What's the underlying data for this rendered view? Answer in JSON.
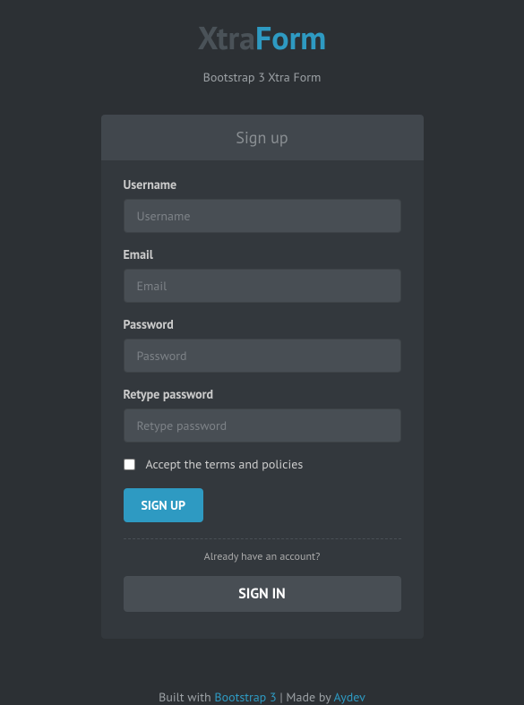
{
  "brand": {
    "part1": "Xtra",
    "part2": "Form"
  },
  "tagline": "Bootstrap 3 Xtra Form",
  "panel": {
    "title": "Sign up"
  },
  "form": {
    "username": {
      "label": "Username",
      "placeholder": "Username",
      "value": ""
    },
    "email": {
      "label": "Email",
      "placeholder": "Email",
      "value": ""
    },
    "password": {
      "label": "Password",
      "placeholder": "Password",
      "value": ""
    },
    "retype": {
      "label": "Retype password",
      "placeholder": "Retype password",
      "value": ""
    },
    "terms": {
      "label": "Accept the terms and policies"
    },
    "signup_button": "Sign up",
    "already_text": "Already have an account?",
    "signin_button": "Sign in"
  },
  "footer": {
    "built_with": "Built with ",
    "bootstrap": "Bootstrap 3",
    "sep": " | ",
    "made_by": "Made by ",
    "author": "Aydev"
  }
}
